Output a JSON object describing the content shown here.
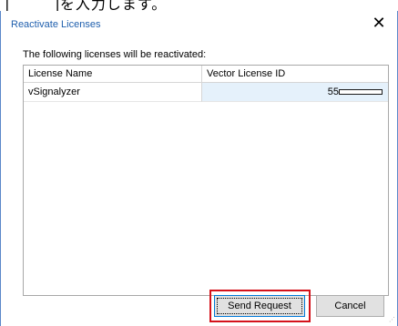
{
  "dialog": {
    "title": "Reactivate Licenses",
    "close_label": "✕",
    "intro_text": "The following licenses will be reactivated:"
  },
  "table": {
    "columns": [
      "License Name",
      "Vector License ID"
    ],
    "rows": [
      {
        "license_name": "vSignalyzer",
        "vector_license_id": "55",
        "progress_fraction": 0.0
      }
    ]
  },
  "buttons": {
    "send_request": "Send Request",
    "cancel": "Cancel"
  },
  "colors": {
    "title_text": "#1f5fad",
    "window_border": "#5b87c9",
    "selected_cell": "#e5f1fb",
    "highlight_box": "#d5121b",
    "default_button_border": "#0078d7"
  }
}
